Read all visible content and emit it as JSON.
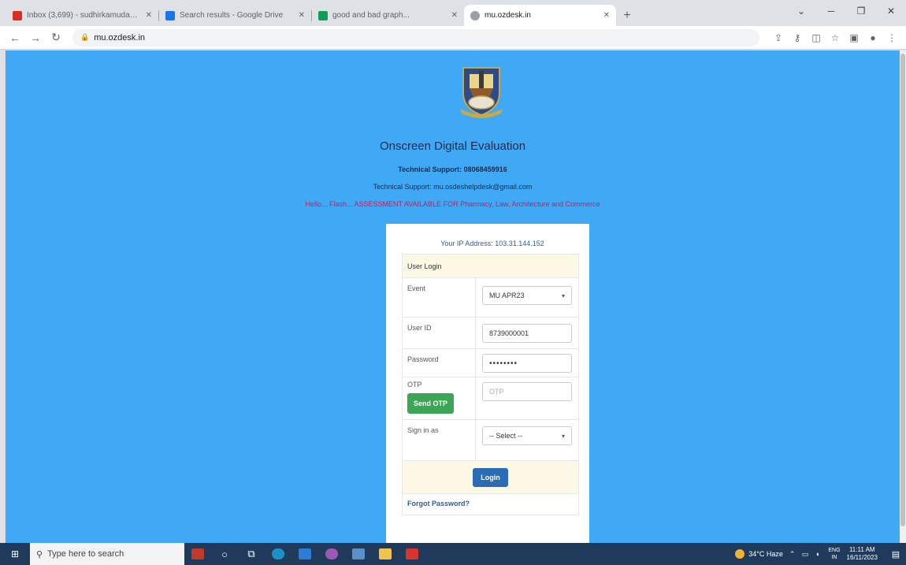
{
  "browser": {
    "tabs": [
      {
        "title": "Inbox (3,699) - sudhirkamuda@...",
        "active": false,
        "color": "#d93025"
      },
      {
        "title": "Search results - Google Drive",
        "active": false,
        "color": "#1a73e8"
      },
      {
        "title": "good and bad graph...",
        "active": false,
        "color": "#0f9d58"
      },
      {
        "title": "mu.ozdesk.in",
        "active": true,
        "color": "#5f6368"
      }
    ],
    "url": "mu.ozdesk.in"
  },
  "page": {
    "heading": "Onscreen Digital Evaluation",
    "support_phone": "Technical Support: 08068459916",
    "support_email": "Technical Support: mu.osdeshelpdesk@gmail.com",
    "notice": "Hello... Flash... ASSESSMENT AVAILABLE FOR Pharmacy, Law, Architecture and Commerce",
    "colors": {
      "background": "#3fa9f5",
      "notice": "#c0205b",
      "send_otp": "#3aa656",
      "login": "#2a6db5"
    }
  },
  "login": {
    "ip_text": "Your IP Address: 103.31.144.152",
    "panel_title": "User Login",
    "event_label": "Event",
    "event_value": "MU APR23",
    "user_id_label": "User ID",
    "user_id_value": "8739000001",
    "password_label": "Password",
    "password_value": "••••••••",
    "otp_label": "OTP",
    "otp_placeholder": "OTP",
    "send_otp_label": "Send OTP",
    "sign_in_as_label": "Sign in as",
    "sign_in_as_value": "-- Select --",
    "login_label": "Login",
    "forgot_label": "Forgot Password?"
  },
  "taskbar": {
    "search_placeholder": "Type here to search",
    "weather": "34°C Haze",
    "lang_top": "ENG",
    "lang_bottom": "IN",
    "time": "11:11 AM",
    "date": "16/11/2023"
  }
}
